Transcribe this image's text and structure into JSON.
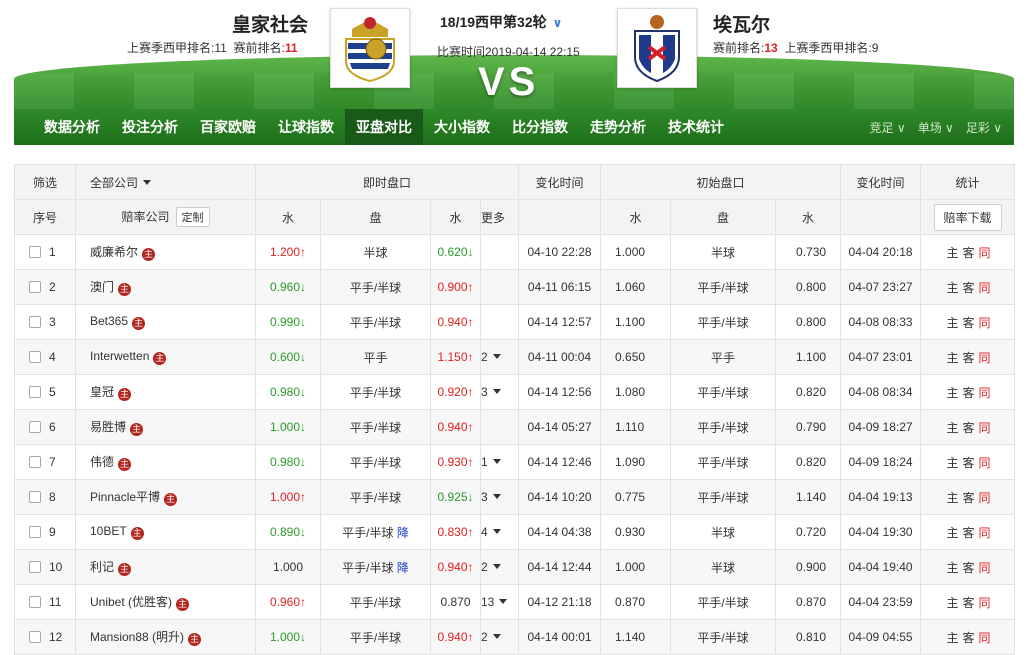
{
  "header": {
    "home_name": "皇家社会",
    "home_last_season_label": "上赛季西甲排名:",
    "home_last_season_rank": "11",
    "home_current_label": "赛前排名:",
    "home_current_rank": "11",
    "away_name": "埃瓦尔",
    "away_current_label": "赛前排名:",
    "away_current_rank": "13",
    "away_last_season_label": "上赛季西甲排名:",
    "away_last_season_rank": "9",
    "match_round": "18/19西甲第32轮",
    "match_time": "比赛时间2019-04-14 22:15",
    "vs": "VS"
  },
  "nav": {
    "items": [
      "数据分析",
      "投注分析",
      "百家欧赔",
      "让球指数",
      "亚盘对比",
      "大小指数",
      "比分指数",
      "走势分析",
      "技术统计"
    ],
    "active_index": 4,
    "right": [
      "竞足",
      "单场",
      "足彩"
    ]
  },
  "table": {
    "head1": {
      "filter": "筛选",
      "all_companies": "全部公司",
      "live": "即时盘口",
      "change_time": "变化时间",
      "initial": "初始盘口",
      "change_time2": "变化时间",
      "stats": "统计"
    },
    "head2": {
      "index": "序号",
      "company": "赔率公司",
      "customize": "定制",
      "water1": "水",
      "handicap": "盘",
      "water2": "水",
      "more": "更多",
      "i_water1": "水",
      "i_handicap": "盘",
      "i_water2": "水",
      "download": "赔率下载"
    },
    "badge": "主",
    "stat_labels": {
      "home": "主",
      "away": "客",
      "same": "同"
    },
    "rows": [
      {
        "no": "1",
        "company": "威廉希尔",
        "w1": "1.200↑",
        "w1c": "up",
        "pan": "半球",
        "pan_flag": "",
        "w2": "0.620↓",
        "w2c": "down",
        "more": "",
        "time": "04-10 22:28",
        "iw1": "1.000",
        "ipan": "半球",
        "iw2": "0.730",
        "itime": "04-04 20:18"
      },
      {
        "no": "2",
        "company": "澳门",
        "w1": "0.960↓",
        "w1c": "down",
        "pan": "平手/半球",
        "pan_flag": "",
        "w2": "0.900↑",
        "w2c": "up",
        "more": "",
        "time": "04-11 06:15",
        "iw1": "1.060",
        "ipan": "平手/半球",
        "iw2": "0.800",
        "itime": "04-07 23:27"
      },
      {
        "no": "3",
        "company": "Bet365",
        "w1": "0.990↓",
        "w1c": "down",
        "pan": "平手/半球",
        "pan_flag": "",
        "w2": "0.940↑",
        "w2c": "up",
        "more": "",
        "time": "04-14 12:57",
        "iw1": "1.100",
        "ipan": "平手/半球",
        "iw2": "0.800",
        "itime": "04-08 08:33"
      },
      {
        "no": "4",
        "company": "Interwetten",
        "w1": "0.600↓",
        "w1c": "down",
        "pan": "平手",
        "pan_flag": "",
        "w2": "1.150↑",
        "w2c": "up",
        "more": "2",
        "time": "04-11 00:04",
        "iw1": "0.650",
        "ipan": "平手",
        "iw2": "1.100",
        "itime": "04-07 23:01"
      },
      {
        "no": "5",
        "company": "皇冠",
        "w1": "0.980↓",
        "w1c": "down",
        "pan": "平手/半球",
        "pan_flag": "",
        "w2": "0.920↑",
        "w2c": "up",
        "more": "3",
        "time": "04-14 12:56",
        "iw1": "1.080",
        "ipan": "平手/半球",
        "iw2": "0.820",
        "itime": "04-08 08:34"
      },
      {
        "no": "6",
        "company": "易胜博",
        "w1": "1.000↓",
        "w1c": "down",
        "pan": "平手/半球",
        "pan_flag": "",
        "w2": "0.940↑",
        "w2c": "up",
        "more": "",
        "time": "04-14 05:27",
        "iw1": "1.110",
        "ipan": "平手/半球",
        "iw2": "0.790",
        "itime": "04-09 18:27"
      },
      {
        "no": "7",
        "company": "伟德",
        "w1": "0.980↓",
        "w1c": "down",
        "pan": "平手/半球",
        "pan_flag": "",
        "w2": "0.930↑",
        "w2c": "up",
        "more": "1",
        "time": "04-14 12:46",
        "iw1": "1.090",
        "ipan": "平手/半球",
        "iw2": "0.820",
        "itime": "04-09 18:24"
      },
      {
        "no": "8",
        "company": "Pinnacle平博",
        "w1": "1.000↑",
        "w1c": "up",
        "pan": "平手/半球",
        "pan_flag": "",
        "w2": "0.925↓",
        "w2c": "down",
        "more": "3",
        "time": "04-14 10:20",
        "iw1": "0.775",
        "ipan": "平手/半球",
        "iw2": "1.140",
        "itime": "04-04 19:13"
      },
      {
        "no": "9",
        "company": "10BET",
        "w1": "0.890↓",
        "w1c": "down",
        "pan": "平手/半球",
        "pan_flag": "降",
        "w2": "0.830↑",
        "w2c": "up",
        "more": "4",
        "time": "04-14 04:38",
        "iw1": "0.930",
        "ipan": "半球",
        "iw2": "0.720",
        "itime": "04-04 19:30"
      },
      {
        "no": "10",
        "company": "利记",
        "w1": "1.000",
        "w1c": "plain",
        "pan": "平手/半球",
        "pan_flag": "降",
        "w2": "0.940↑",
        "w2c": "up",
        "more": "2",
        "time": "04-14 12:44",
        "iw1": "1.000",
        "ipan": "半球",
        "iw2": "0.900",
        "itime": "04-04 19:40"
      },
      {
        "no": "11",
        "company": "Unibet (优胜客)",
        "w1": "0.960↑",
        "w1c": "up",
        "pan": "平手/半球",
        "pan_flag": "",
        "w2": "0.870",
        "w2c": "plain",
        "more": "13",
        "time": "04-12 21:18",
        "iw1": "0.870",
        "ipan": "平手/半球",
        "iw2": "0.870",
        "itime": "04-04 23:59"
      },
      {
        "no": "12",
        "company": "Mansion88 (明升)",
        "w1": "1.000↓",
        "w1c": "down",
        "pan": "平手/半球",
        "pan_flag": "",
        "w2": "0.940↑",
        "w2c": "up",
        "more": "2",
        "time": "04-14 00:01",
        "iw1": "1.140",
        "ipan": "平手/半球",
        "iw2": "0.810",
        "itime": "04-09 04:55"
      }
    ]
  },
  "colors": {
    "up": "#e02020",
    "down": "#2a9a2a",
    "nav_green": "#1e6e1b",
    "badge": "#b3261e"
  }
}
